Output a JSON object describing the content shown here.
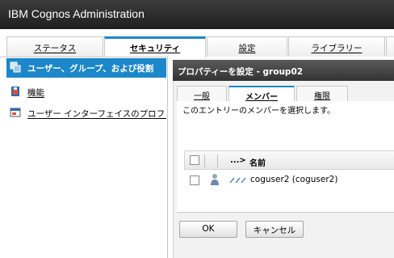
{
  "app": {
    "title": "IBM Cognos Administration"
  },
  "tabs": [
    {
      "label": "ステータス",
      "active": false
    },
    {
      "label": "セキュリティ",
      "active": true
    },
    {
      "label": "設定",
      "active": false
    },
    {
      "label": "ライブラリー",
      "active": false
    }
  ],
  "left_nav": {
    "items": [
      {
        "label": "ユーザー、グループ、および役割",
        "icon": "users-groups-icon",
        "selected": true
      },
      {
        "label": "機能",
        "icon": "capability-lock-icon",
        "selected": false
      },
      {
        "label": "ユーザー インターフェイスのプロファ",
        "icon": "ui-profile-icon",
        "selected": false
      }
    ]
  },
  "properties": {
    "title": "プロパティーを設定 - group02",
    "subtabs": [
      {
        "label": "一般",
        "active": false
      },
      {
        "label": "メンバー",
        "active": true
      },
      {
        "label": "権限",
        "active": false
      }
    ],
    "instruction": "このエントリーのメンバーを選択します。",
    "list": {
      "sort_marker": "...>",
      "name_header": "名前",
      "rows": [
        {
          "name": "coguser2 (coguser2)",
          "icon": "user-icon"
        }
      ]
    },
    "buttons": {
      "ok": "OK",
      "cancel": "キャンセル"
    }
  },
  "colors": {
    "accent": "#1c87c9",
    "header_bg": "#2a2a2a",
    "panel_header_bg": "#444444"
  }
}
